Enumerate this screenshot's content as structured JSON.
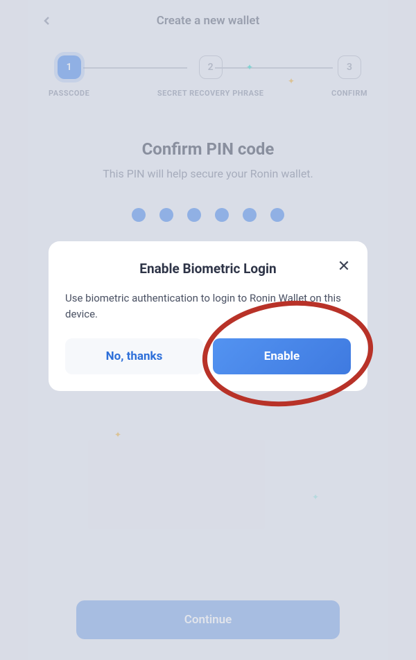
{
  "header": {
    "title": "Create a new wallet"
  },
  "stepper": {
    "steps": [
      {
        "num": "1",
        "label": "PASSCODE"
      },
      {
        "num": "2",
        "label": "SECRET RECOVERY PHRASE"
      },
      {
        "num": "3",
        "label": "CONFIRM"
      }
    ]
  },
  "main": {
    "title": "Confirm PIN code",
    "subtitle": "This PIN will help secure your Ronin wallet."
  },
  "modal": {
    "title": "Enable Biometric Login",
    "description": "Use biometric authentication to login to Ronin Wallet on this device.",
    "decline_label": "No, thanks",
    "accept_label": "Enable"
  },
  "footer": {
    "continue_label": "Continue"
  }
}
